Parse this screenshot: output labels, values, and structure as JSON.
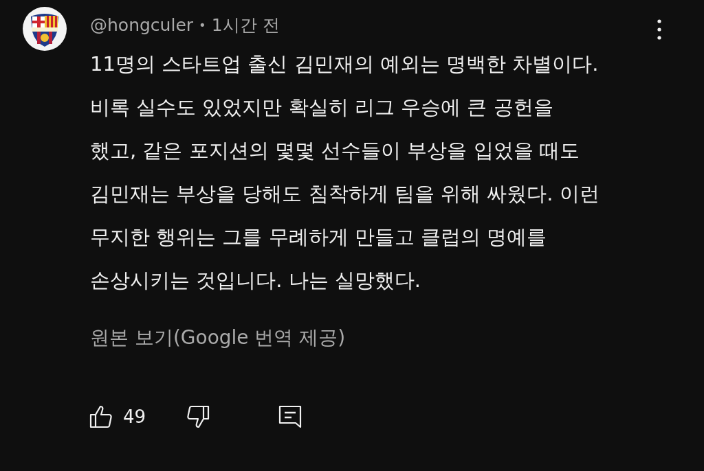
{
  "comment": {
    "author": "@hongculer",
    "separator": "•",
    "time": "1시간 전",
    "text_lines": [
      "11명의 스타트업 출신 김민재의 예외는 명백한 차별이다.",
      "비록 실수도 있었지만 확실히 리그 우승에 큰 공헌을",
      "했고, 같은 포지션의 몇몇 선수들이 부상을 입었을 때도",
      "김민재는 부상을 당해도 침착하게 팀을 위해 싸웠다. 이런",
      "무지한 행위는 그를 무례하게 만들고 클럽의 명예를",
      "손상시키는 것입니다. 나는 실망했다."
    ],
    "translation_link": "원본 보기(Google 번역 제공)",
    "like_count": "49"
  }
}
